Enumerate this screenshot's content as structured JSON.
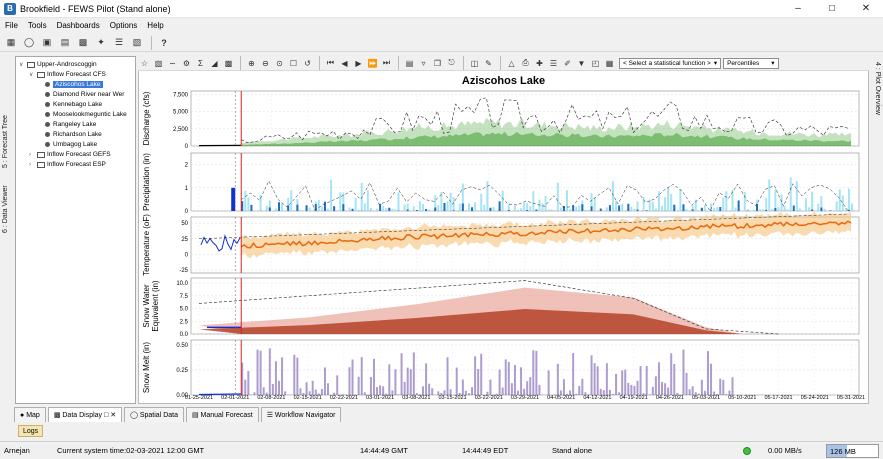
{
  "window": {
    "title": "Brookfield - FEWS Pilot  (Stand alone)"
  },
  "menu": [
    "File",
    "Tools",
    "Dashboards",
    "Options",
    "Help"
  ],
  "left_tabs": {
    "forecast_tree": "5 : Forecast Tree",
    "data_viewer": "6 : Data Viewer"
  },
  "right_tab": "4 : Plot Overview",
  "tree": {
    "root": "Upper-Androscoggin",
    "cfs_group": "Inflow Forecast CFS",
    "lakes": [
      "Aziscohos Lake",
      "Diamond River near Wer",
      "Kennebago Lake",
      "Mooselookmeguntic Lake",
      "Rangeley  Lake",
      "Richardson Lake",
      "Umbagog Lake"
    ],
    "gefs_group": "Inflow Forecast GEFS",
    "esp_group": "Inflow Forecast ESP"
  },
  "toolbar2": {
    "stat_function": "< Select a statistical function >",
    "percentiles": "Percentiles"
  },
  "bottom_tabs": [
    "Map",
    "Data Display",
    "Spatial Data",
    "Manual Forecast",
    "Workflow Navigator"
  ],
  "logs_label": "Logs",
  "status": {
    "user": "Arnejan",
    "system_time": "Current system time:02-03-2021 12:00 GMT",
    "gmt": "14:44:49 GMT",
    "edt": "14:44:49 EDT",
    "mode": "Stand alone",
    "rate": "0.00 MB/s",
    "memory": "126 MB",
    "memory_fraction": 0.4
  },
  "colors": {
    "forecast_line": "#e02020",
    "observed": "#1030d0",
    "discharge": "#3f9f2f",
    "precip": "#80d8f0",
    "temperature": "#e66a10",
    "swe": "#b13a20",
    "snowmelt": "#6a4aa8"
  },
  "chart_data": [
    {
      "type": "area",
      "title": "Aziscohos Lake",
      "ylabel": "Discharge (cfs)",
      "ylim": [
        0,
        8000
      ],
      "yticks": [
        "0",
        "2,500",
        "5,000",
        "7,500"
      ],
      "x": [
        "01-25-2021",
        "02-01-2021",
        "02-08-2021",
        "02-15-2021",
        "02-22-2021",
        "03-01-2021",
        "03-08-2021",
        "03-15-2021",
        "03-22-2021",
        "03-29-2021",
        "04-05-2021",
        "04-12-2021",
        "04-19-2021",
        "04-26-2021",
        "05-03-2021",
        "05-10-2021",
        "05-17-2021",
        "05-24-2021",
        "05-31-2021"
      ],
      "series": [
        {
          "values": [
            300,
            400,
            800,
            1200,
            1500,
            1900,
            2600,
            2800,
            3300,
            3000,
            2900,
            2500,
            2700,
            3100,
            2500,
            2000,
            1800,
            1600,
            1500
          ]
        },
        {
          "values": [
            100,
            150,
            300,
            500,
            700,
            900,
            1300,
            1500,
            1800,
            1700,
            1600,
            1400,
            1500,
            1700,
            1400,
            1100,
            900,
            800,
            700
          ]
        }
      ]
    },
    {
      "type": "area",
      "ylabel": "Precipitation (in)",
      "ylim": [
        0,
        2.5
      ],
      "yticks": [
        "0",
        "1",
        "2"
      ]
    },
    {
      "type": "area",
      "ylabel": "Temperature (oF)",
      "ylim": [
        -30,
        60
      ],
      "yticks": [
        "-25",
        "0",
        "25",
        "50"
      ],
      "x": [
        "01-25-2021",
        "02-15-2021",
        "03-08-2021",
        "03-29-2021",
        "04-19-2021",
        "05-10-2021",
        "05-31-2021"
      ],
      "series": [
        {
          "values": [
            10,
            18,
            28,
            34,
            40,
            46,
            52
          ]
        }
      ]
    },
    {
      "type": "area",
      "ylabel": "Snow Water Equivalent (in)",
      "ylim": [
        0,
        11
      ],
      "yticks": [
        "0.0",
        "2.5",
        "5.0",
        "7.5",
        "10.0"
      ],
      "x": [
        "01-25-2021",
        "02-15-2021",
        "03-08-2021",
        "03-29-2021",
        "04-19-2021",
        "05-03-2021",
        "05-10-2021"
      ],
      "series": [
        {
          "values": [
            1.3,
            2.5,
            4.5,
            7.0,
            5.5,
            1.0,
            0.0
          ]
        }
      ]
    },
    {
      "type": "area",
      "ylabel": "Snow Melt (in)",
      "ylim": [
        0,
        0.55
      ],
      "yticks": [
        "0.00",
        "0.25",
        "0.50"
      ]
    }
  ]
}
